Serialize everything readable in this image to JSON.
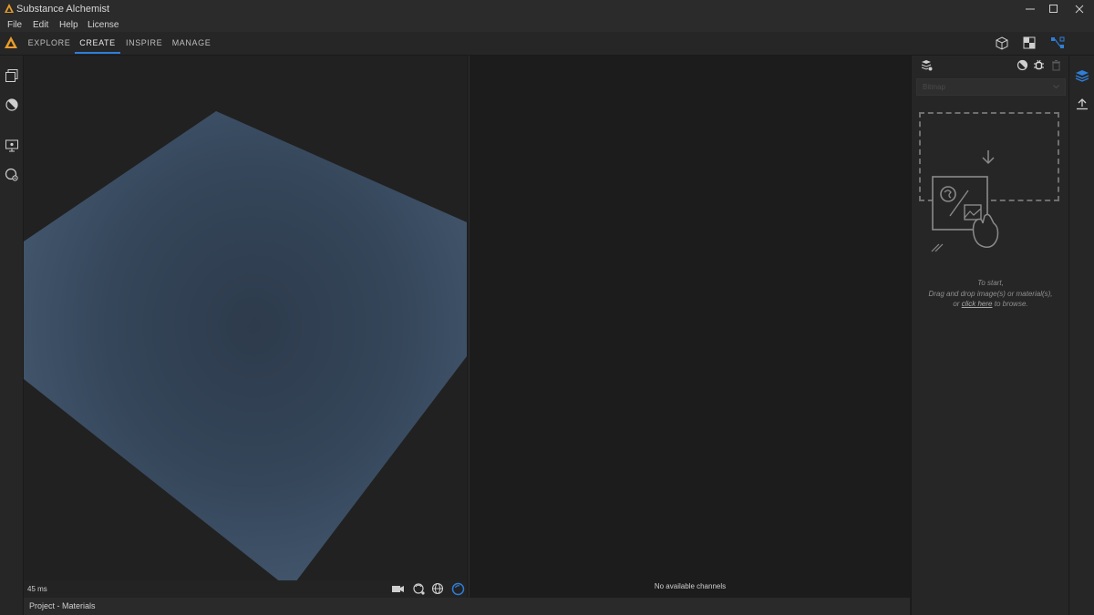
{
  "window": {
    "title": "Substance Alchemist",
    "controls": [
      "minimize-icon",
      "maximize-icon",
      "close-icon"
    ]
  },
  "menu": [
    "File",
    "Edit",
    "Help",
    "License"
  ],
  "nav": {
    "tabs": [
      {
        "label": "EXPLORE",
        "active": false
      },
      {
        "label": "CREATE",
        "active": true
      },
      {
        "label": "INSPIRE",
        "active": false
      },
      {
        "label": "MANAGE",
        "active": false
      }
    ],
    "right_icons": [
      "cube-icon",
      "checker-icon",
      "node-graph-icon"
    ]
  },
  "left_rail": [
    "library-icon",
    "material-ball-icon",
    "display-settings-icon",
    "environment-settings-icon"
  ],
  "viewport": {
    "frame_time": "45 ms",
    "toolbar_icons": [
      "camera-icon",
      "light-rotate-icon",
      "environment-icon",
      "shading-sphere-icon"
    ]
  },
  "channel_view": {
    "empty_text": "No available channels"
  },
  "bottom_bar": {
    "project_label": "Project - Materials"
  },
  "right_panel": {
    "header_icons": [
      "layers-settings-icon",
      "material-ball-icon",
      "bug-icon",
      "trash-icon"
    ],
    "dropdown_value": "Bitmap",
    "drop_msg_line1": "To start,",
    "drop_msg_line2": "Drag and drop image(s) or material(s),",
    "drop_msg_prefix": "or ",
    "drop_msg_link": "click here",
    "drop_msg_suffix": " to browse."
  },
  "right_rail": [
    "layers-icon",
    "export-icon"
  ],
  "colors": {
    "accent": "#2f7ed8",
    "logo": "#e89c2a",
    "plane": "#3b4d63"
  }
}
